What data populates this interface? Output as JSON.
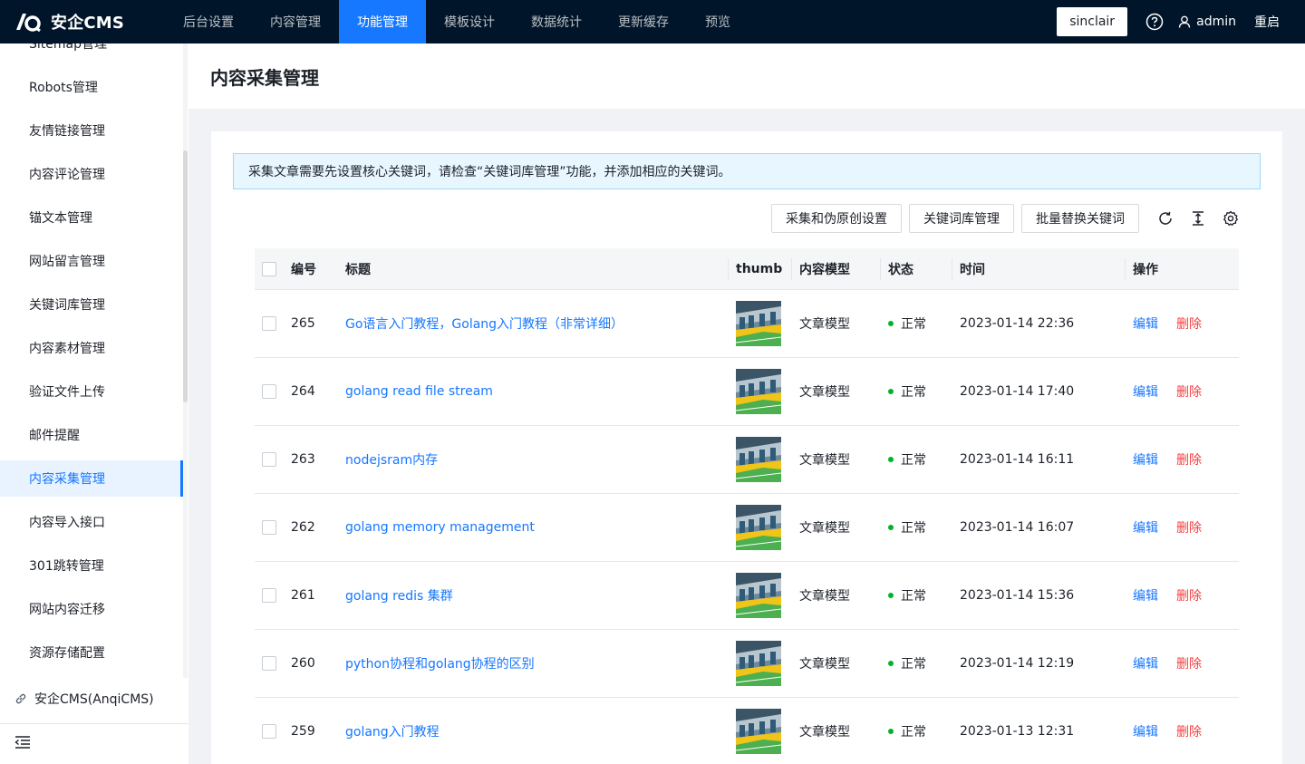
{
  "app": {
    "name": "安企CMS",
    "nav": [
      {
        "label": "后台设置",
        "active": false
      },
      {
        "label": "内容管理",
        "active": false
      },
      {
        "label": "功能管理",
        "active": true
      },
      {
        "label": "模板设计",
        "active": false
      },
      {
        "label": "数据统计",
        "active": false
      },
      {
        "label": "更新缓存",
        "active": false
      },
      {
        "label": "预览",
        "active": false
      }
    ],
    "site_button": "sinclair",
    "user": "admin",
    "restart": "重启"
  },
  "sidebar": {
    "items": [
      {
        "label": "Sitemap管理",
        "active": false
      },
      {
        "label": "Robots管理",
        "active": false
      },
      {
        "label": "友情链接管理",
        "active": false
      },
      {
        "label": "内容评论管理",
        "active": false
      },
      {
        "label": "锚文本管理",
        "active": false
      },
      {
        "label": "网站留言管理",
        "active": false
      },
      {
        "label": "关键词库管理",
        "active": false
      },
      {
        "label": "内容素材管理",
        "active": false
      },
      {
        "label": "验证文件上传",
        "active": false
      },
      {
        "label": "邮件提醒",
        "active": false
      },
      {
        "label": "内容采集管理",
        "active": true
      },
      {
        "label": "内容导入接口",
        "active": false
      },
      {
        "label": "301跳转管理",
        "active": false
      },
      {
        "label": "网站内容迁移",
        "active": false
      },
      {
        "label": "资源存储配置",
        "active": false
      }
    ],
    "footer_link": "安企CMS(AnqiCMS)"
  },
  "page": {
    "title": "内容采集管理",
    "alert": "采集文章需要先设置核心关键词，请检查“关键词库管理”功能，并添加相应的关键词。",
    "toolbar": {
      "btn1": "采集和伪原创设置",
      "btn2": "关键词库管理",
      "btn3": "批量替换关键词"
    }
  },
  "table": {
    "headers": {
      "id": "编号",
      "title": "标题",
      "thumb": "thumb",
      "model": "内容模型",
      "status": "状态",
      "time": "时间",
      "ops": "操作"
    },
    "rows": [
      {
        "id": "265",
        "title": "Go语言入门教程，Golang入门教程（非常详细）",
        "model": "文章模型",
        "status": "正常",
        "time": "2023-01-14 22:36",
        "edit": "编辑",
        "del": "删除"
      },
      {
        "id": "264",
        "title": "golang read file stream",
        "model": "文章模型",
        "status": "正常",
        "time": "2023-01-14 17:40",
        "edit": "编辑",
        "del": "删除"
      },
      {
        "id": "263",
        "title": "nodejsram内存",
        "model": "文章模型",
        "status": "正常",
        "time": "2023-01-14 16:11",
        "edit": "编辑",
        "del": "删除"
      },
      {
        "id": "262",
        "title": "golang memory management",
        "model": "文章模型",
        "status": "正常",
        "time": "2023-01-14 16:07",
        "edit": "编辑",
        "del": "删除"
      },
      {
        "id": "261",
        "title": "golang redis 集群",
        "model": "文章模型",
        "status": "正常",
        "time": "2023-01-14 15:36",
        "edit": "编辑",
        "del": "删除"
      },
      {
        "id": "260",
        "title": "python协程和golang协程的区别",
        "model": "文章模型",
        "status": "正常",
        "time": "2023-01-14 12:19",
        "edit": "编辑",
        "del": "删除"
      },
      {
        "id": "259",
        "title": "golang入门教程",
        "model": "文章模型",
        "status": "正常",
        "time": "2023-01-13 12:31",
        "edit": "编辑",
        "del": "删除"
      }
    ]
  },
  "colors": {
    "topbar": "#001529",
    "primary": "#1677ff",
    "danger": "#f53f3f",
    "success": "#00b42a"
  }
}
